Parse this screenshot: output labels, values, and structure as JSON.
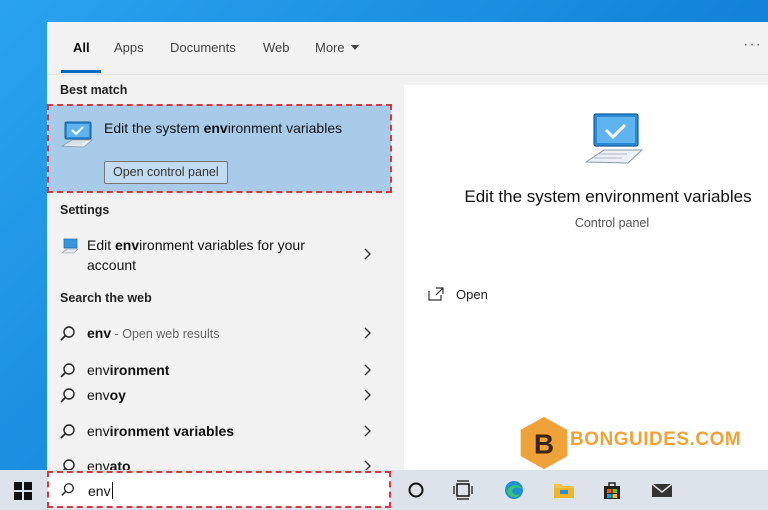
{
  "tabs": [
    {
      "label": "All"
    },
    {
      "label": "Apps"
    },
    {
      "label": "Documents"
    },
    {
      "label": "Web"
    },
    {
      "label": "More"
    }
  ],
  "more_dots": "···",
  "best_match": {
    "heading": "Best match",
    "title_pre": "Edit the system ",
    "title_bold": "env",
    "title_post": "ironment variables",
    "button": "Open control panel"
  },
  "settings": {
    "heading": "Settings",
    "item_pre": "Edit ",
    "item_bold": "env",
    "item_post": "ironment variables for your account"
  },
  "web": {
    "heading": "Search the web",
    "items": [
      {
        "bold": "env",
        "rest": "",
        "sub": " - Open web results"
      },
      {
        "bold": "",
        "pre": "env",
        "rest": "ironment",
        "sub": ""
      },
      {
        "bold": "",
        "pre": "env",
        "rest": "oy",
        "sub": ""
      },
      {
        "bold": "",
        "pre": "env",
        "rest": "ironment variables",
        "sub": ""
      },
      {
        "bold": "",
        "pre": "env",
        "rest": "ato",
        "sub": ""
      }
    ]
  },
  "preview": {
    "title": "Edit the system environment variables",
    "subtitle": "Control panel",
    "open_label": "Open"
  },
  "watermark": "BONGUIDES.COM",
  "taskbar": {
    "search_value": "env"
  },
  "colors": {
    "accent": "#0067c0",
    "selection": "#a8cbe9",
    "highlight_border": "#d9363e"
  }
}
